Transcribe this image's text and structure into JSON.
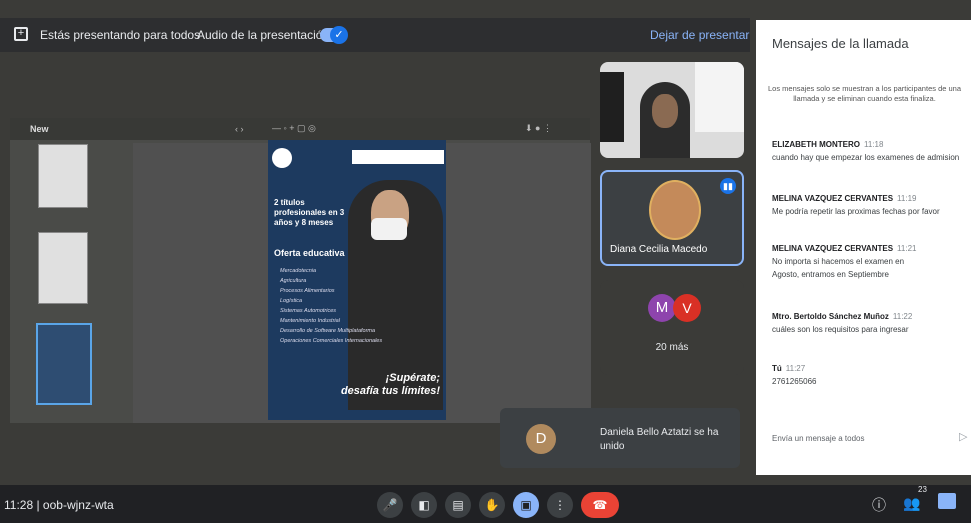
{
  "topbar": {
    "presenting_text": "Estás presentando para todos",
    "audio_label": "Audio de la presentación",
    "stop_label": "Dejar de presentar"
  },
  "slides": {
    "toolbar_name": "New"
  },
  "poster": {
    "titulos": "2 títulos profesionales en 3 años y 8 meses",
    "oferta_title": "Oferta educativa",
    "oferta_items": [
      "Mercadotecnia",
      "Agricultura",
      "Procesos Alimentarios",
      "Logística",
      "Sistemas Automotrices",
      "Mantenimiento Industrial",
      "Desarrollo de Software Multiplataforma",
      "Operaciones Comerciales Internacionales"
    ],
    "slogan_1": "¡Supérate;",
    "slogan_2": "desafía tus límites!"
  },
  "participants": {
    "diana_name": "Diana Cecilia Macedo",
    "avatar_m": "M",
    "avatar_v": "V",
    "more_text": "20 más"
  },
  "toast": {
    "avatar_letter": "D",
    "text": "Daniela Bello Aztatzi se ha unido"
  },
  "chat": {
    "title": "Mensajes de la llamada",
    "info": "Los mensajes solo se muestran a los participantes de una llamada y se eliminan cuando esta finaliza.",
    "messages": [
      {
        "sender": "ELIZABETH MONTERO",
        "time": "11:18",
        "text": "cuando hay que empezar los examenes de admision"
      },
      {
        "sender": "MELINA VAZQUEZ CERVANTES",
        "time": "11:19",
        "text": "Me podría repetir las proximas fechas por favor"
      },
      {
        "sender": "MELINA VAZQUEZ CERVANTES",
        "time": "11:21",
        "text": "No importa si hacemos el examen en Agosto, entramos en Septiembre"
      },
      {
        "sender": "Mtro. Bertoldo Sánchez Muñoz",
        "time": "11:22",
        "text": "cuáles son los requisitos para ingresar"
      },
      {
        "sender": "Tú",
        "time": "11:27",
        "text": "2761265066"
      }
    ],
    "input_placeholder": "Envía un mensaje a todos"
  },
  "bottombar": {
    "meeting_info": "11:28 | oob-wjnz-wta",
    "people_count": "23"
  },
  "colors": {
    "accent": "#8ab4f8",
    "end_call": "#ea4335",
    "bar": "#202124"
  }
}
